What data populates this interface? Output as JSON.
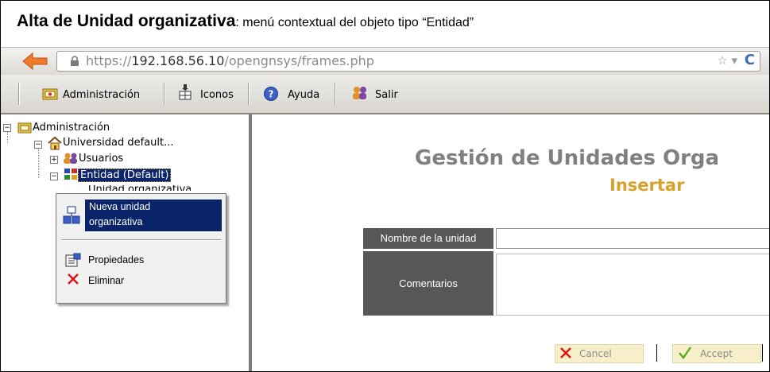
{
  "caption": {
    "bold": "Alta de Unidad organizativa",
    "rest": ": menú contextual del objeto tipo “Entidad”"
  },
  "browser": {
    "url_prefix": "https://",
    "url_host": "192.168.56.10",
    "url_path": "/opengnsys/frames.php"
  },
  "toolbar": {
    "items": [
      {
        "label": "Administración",
        "icon": "admin-icon"
      },
      {
        "label": "Iconos",
        "icon": "icons-icon"
      },
      {
        "label": "Ayuda",
        "icon": "help-icon"
      },
      {
        "label": "Salir",
        "icon": "exit-icon"
      }
    ]
  },
  "tree": {
    "root": "Administración",
    "university": "Universidad default...",
    "users": "Usuarios",
    "entity": "Entidad (Default)",
    "org_unit_partial": "Unidad organizativa"
  },
  "context_menu": {
    "new_unit_line1": "Nueva unidad",
    "new_unit_line2": "organizativa",
    "properties": "Propiedades",
    "delete": "Eliminar"
  },
  "main": {
    "title": "Gestión de Unidades Orga",
    "subtitle": "Insertar",
    "name_label": "Nombre de la unidad",
    "comments_label": "Comentarios",
    "cancel": "Cancel",
    "accept": "Accept"
  },
  "colors": {
    "title_gray": "#808080",
    "subtitle_gold": "#d9a12a",
    "label_cell_bg": "#575757",
    "menu_highlight": "#0a246a"
  }
}
